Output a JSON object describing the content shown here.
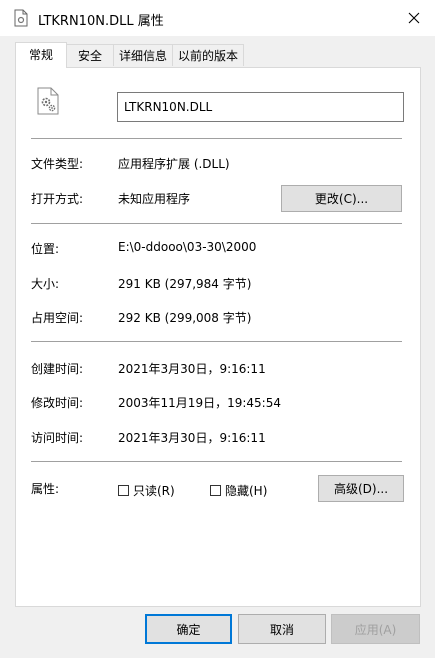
{
  "window": {
    "title": "LTKRN10N.DLL 属性"
  },
  "tabs": [
    "常规",
    "安全",
    "详细信息",
    "以前的版本"
  ],
  "file": {
    "name": "LTKRN10N.DLL"
  },
  "props": {
    "type_label": "文件类型:",
    "type_value": "应用程序扩展 (.DLL)",
    "opens_label": "打开方式:",
    "opens_value": "未知应用程序",
    "change_button": "更改(C)...",
    "location_label": "位置:",
    "location_value": "E:\\0-ddooo\\03-30\\2000",
    "size_label": "大小:",
    "size_value": "291 KB (297,984 字节)",
    "disk_label": "占用空间:",
    "disk_value": "292 KB (299,008 字节)",
    "created_label": "创建时间:",
    "created_value": "2021年3月30日，9:16:11",
    "modified_label": "修改时间:",
    "modified_value": "2003年11月19日，19:45:54",
    "accessed_label": "访问时间:",
    "accessed_value": "2021年3月30日，9:16:11",
    "attributes_label": "属性:",
    "readonly_label": "只读(R)",
    "hidden_label": "隐藏(H)",
    "advanced_button": "高级(D)..."
  },
  "footer": {
    "ok": "确定",
    "cancel": "取消",
    "apply": "应用(A)"
  }
}
